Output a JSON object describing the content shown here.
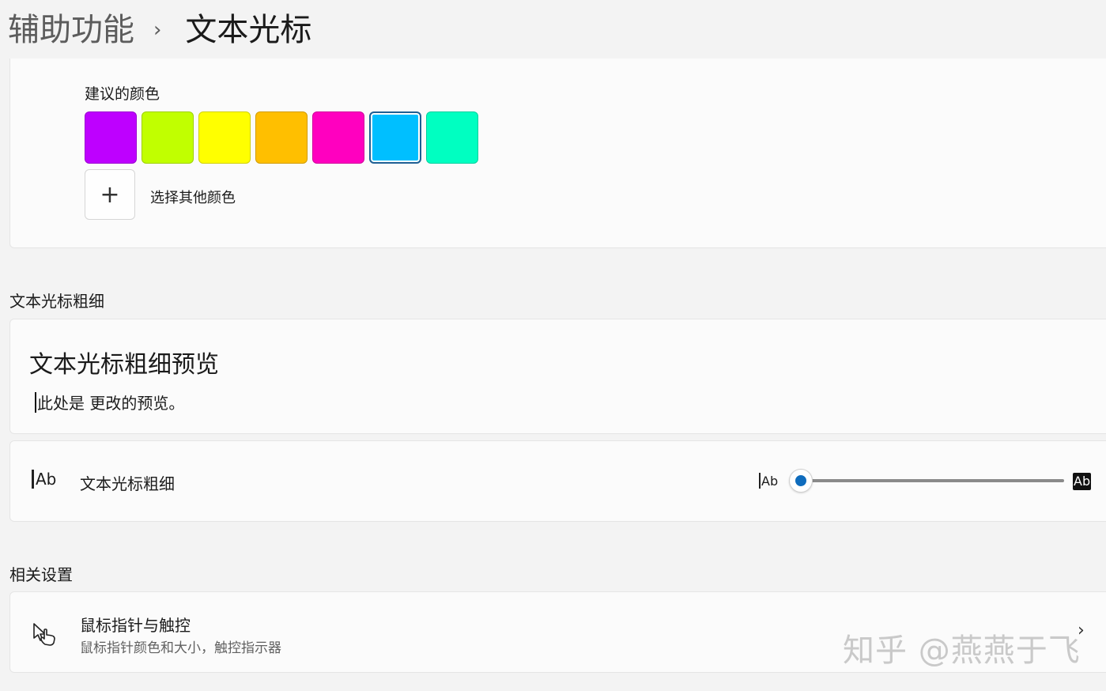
{
  "breadcrumb": {
    "parent": "辅助功能",
    "separator": "›",
    "current": "文本光标"
  },
  "colors": {
    "suggested_label": "建议的颜色",
    "swatches": [
      "#be00ff",
      "#c1ff00",
      "#ffff00",
      "#ffbf00",
      "#ff00bf",
      "#00bfff",
      "#00ffc1"
    ],
    "selected_index": 5,
    "add_icon": "plus-icon",
    "add_symbol": "+",
    "add_label": "选择其他颜色"
  },
  "thickness_section": {
    "title": "文本光标粗细",
    "preview_title": "文本光标粗细预览",
    "preview_text": "此处是 更改的预览。",
    "setting_label": "文本光标粗细",
    "icon": "text-cursor-icon",
    "icon_text": "Ab",
    "slider_min_text": "Ab",
    "slider_max_text": "Ab",
    "slider_value": 0.0,
    "accent": "#0f6cbd"
  },
  "related": {
    "title": "相关设置",
    "item_title": "鼠标指针与触控",
    "item_subtitle": "鼠标指针颜色和大小，触控指示器",
    "item_icon": "mouse-pointer-touch-icon",
    "chevron": "›"
  },
  "watermark": "知乎 @燕燕于飞"
}
